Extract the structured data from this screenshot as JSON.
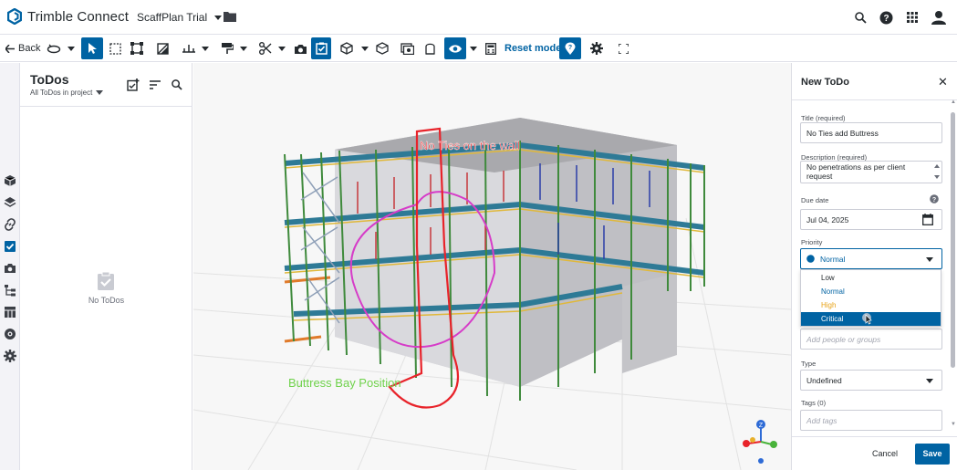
{
  "app": {
    "name": "Trimble Connect",
    "project": "ScaffPlan Trial"
  },
  "toolbar": {
    "back_label": "Back",
    "reset_label": "Reset model"
  },
  "todos": {
    "title": "ToDos",
    "filter": "All ToDos in project",
    "empty": "No ToDos"
  },
  "viewport": {
    "markup_top": "No Ties on the wall",
    "markup_bottom": "Buttress Bay Position"
  },
  "new_todo": {
    "title": "New ToDo",
    "title_label": "Title (required)",
    "title_value": "No Ties add Buttress",
    "desc_label": "Description (required)",
    "desc_value": "No penetrations as per client request",
    "due_label": "Due date",
    "due_value": "Jul 04, 2025",
    "priority_label": "Priority",
    "priority_value": "Normal",
    "priority_options": [
      {
        "label": "Low",
        "color": "#6a6e79"
      },
      {
        "label": "Normal",
        "color": "#0063a3"
      },
      {
        "label": "High",
        "color": "#e8a317"
      },
      {
        "label": "Critical",
        "color": "#ffffff"
      }
    ],
    "assignee_placeholder": "Add people or groups",
    "type_label": "Type",
    "type_value": "Undefined",
    "tags_label": "Tags (0)",
    "tags_placeholder": "Add tags",
    "cancel_label": "Cancel",
    "save_label": "Save"
  },
  "colors": {
    "accent": "#0063a3",
    "markup_red": "#e8232a",
    "markup_magenta": "#d63cc8",
    "markup_green": "#6fd24b"
  }
}
